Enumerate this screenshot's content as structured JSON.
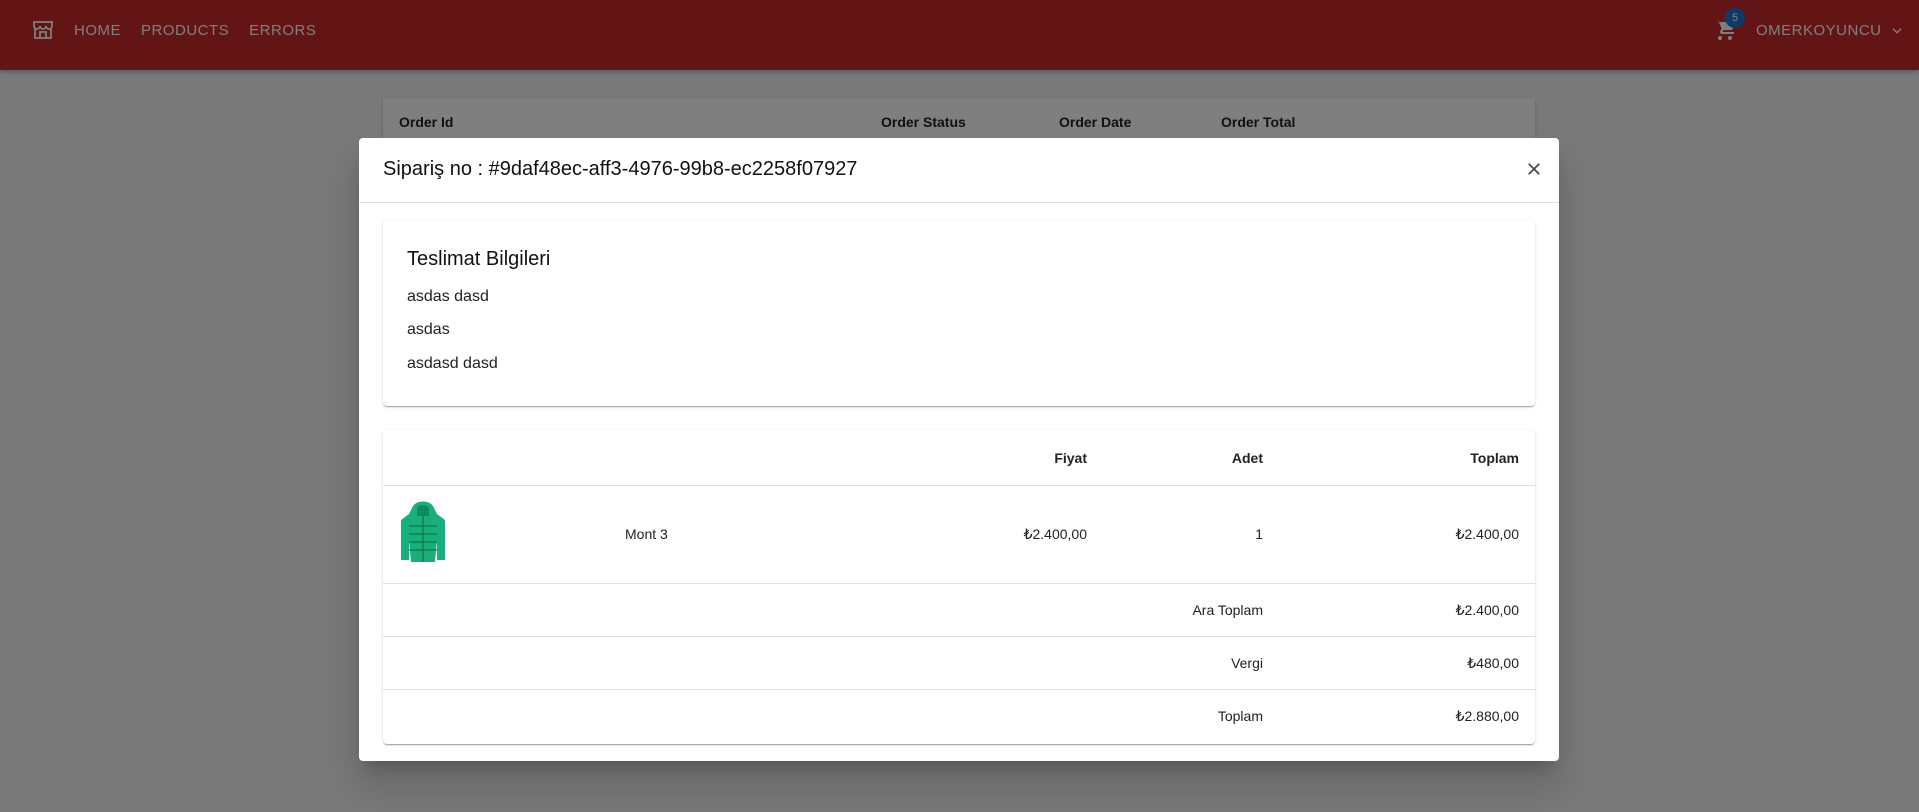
{
  "navbar": {
    "items": [
      "HOME",
      "PRODUCTS",
      "ERRORS"
    ],
    "cart_count": "5",
    "user_name": "OMERKOYUNCU",
    "bar_color": "#c62828",
    "badge_color": "#1976d2"
  },
  "background_table": {
    "headers": [
      "Order Id",
      "Order Status",
      "Order Date",
      "Order Total"
    ]
  },
  "dialog": {
    "title": "Sipariş no : #9daf48ec-aff3-4976-99b8-ec2258f07927",
    "delivery": {
      "title": "Teslimat Bilgileri",
      "lines": [
        "asdas dasd",
        "asdas",
        "asdasd dasd"
      ]
    },
    "items_table": {
      "headers": {
        "price": "Fiyat",
        "quantity": "Adet",
        "total": "Toplam"
      },
      "rows": [
        {
          "name": "Mont 3",
          "price": "₺2.400,00",
          "quantity": "1",
          "total": "₺2.400,00",
          "image_icon": "green-jacket"
        }
      ],
      "summary": [
        {
          "label": "Ara Toplam",
          "value": "₺2.400,00"
        },
        {
          "label": "Vergi",
          "value": "₺480,00"
        },
        {
          "label": "Toplam",
          "value": "₺2.880,00"
        }
      ]
    }
  }
}
